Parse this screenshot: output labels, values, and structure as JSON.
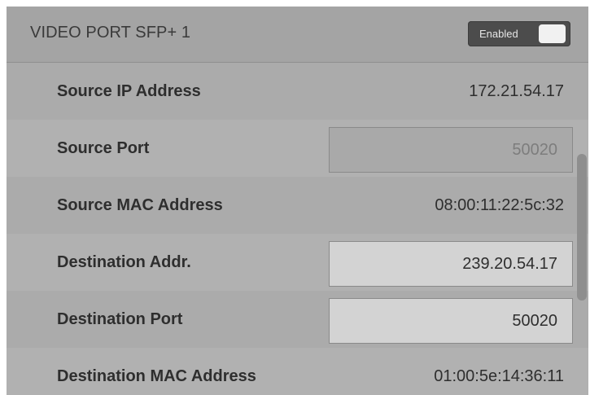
{
  "header": {
    "title": "VIDEO PORT SFP+ 1",
    "toggle_label": "Enabled"
  },
  "rows": [
    {
      "label": "Source IP Address",
      "value": "172.21.54.17",
      "kind": "readonly"
    },
    {
      "label": "Source Port",
      "value": "50020",
      "kind": "input-disabled"
    },
    {
      "label": "Source MAC Address",
      "value": "08:00:11:22:5c:32",
      "kind": "readonly"
    },
    {
      "label": "Destination Addr.",
      "value": "239.20.54.17",
      "kind": "input"
    },
    {
      "label": "Destination Port",
      "value": "50020",
      "kind": "input"
    },
    {
      "label": "Destination MAC Address",
      "value": "01:00:5e:14:36:11",
      "kind": "readonly"
    }
  ],
  "colors": {
    "panel_bg": "#ababab",
    "toggle_bg": "#4c4c4c",
    "field_bg": "#d3d3d3"
  }
}
